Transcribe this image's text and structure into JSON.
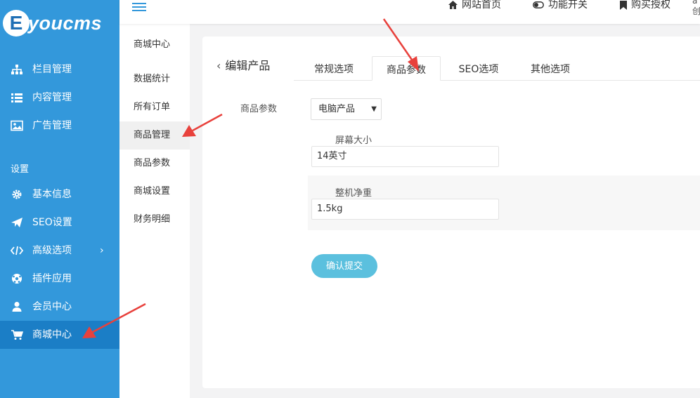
{
  "brand": {
    "logo_letter": "E",
    "logo_text": "youcms"
  },
  "sidebar": {
    "items": [
      {
        "label": "栏目管理",
        "icon": "sitemap-icon"
      },
      {
        "label": "内容管理",
        "icon": "list-icon"
      },
      {
        "label": "广告管理",
        "icon": "image-icon"
      }
    ],
    "section_title": "设置",
    "settings_items": [
      {
        "label": "基本信息",
        "icon": "gear-icon"
      },
      {
        "label": "SEO设置",
        "icon": "paper-plane-icon"
      },
      {
        "label": "高级选项",
        "icon": "code-icon",
        "arrow": "›"
      },
      {
        "label": "插件应用",
        "icon": "soccer-ball-icon"
      },
      {
        "label": "会员中心",
        "icon": "user-icon"
      },
      {
        "label": "商城中心",
        "icon": "cart-icon",
        "active": true
      }
    ]
  },
  "submenu": {
    "title": "商城中心",
    "items": [
      "数据统计",
      "所有订单",
      "商品管理",
      "商品参数",
      "商城设置",
      "财务明细"
    ],
    "active_item": "商品管理"
  },
  "topbar": {
    "home_link": "网站首页",
    "feature_toggle": "功能开关",
    "buy_license": "购买授权",
    "user_line1": "a",
    "user_line2": "创"
  },
  "editor": {
    "back_title": "编辑产品",
    "tabs": [
      "常规选项",
      "商品参数",
      "SEO选项",
      "其他选项"
    ],
    "active_tab": "商品参数",
    "param_label": "商品参数",
    "param_type_selected": "电脑产品",
    "params": [
      {
        "label": "屏幕大小",
        "value": "14英寸"
      },
      {
        "label": "整机净重",
        "value": "1.5kg"
      }
    ],
    "submit_label": "确认提交"
  },
  "colors": {
    "sidebar_bg": "#3398db",
    "sidebar_active": "#1b7ec6",
    "submit_button": "#5bc0de",
    "annotation_arrow": "#e8413c"
  }
}
